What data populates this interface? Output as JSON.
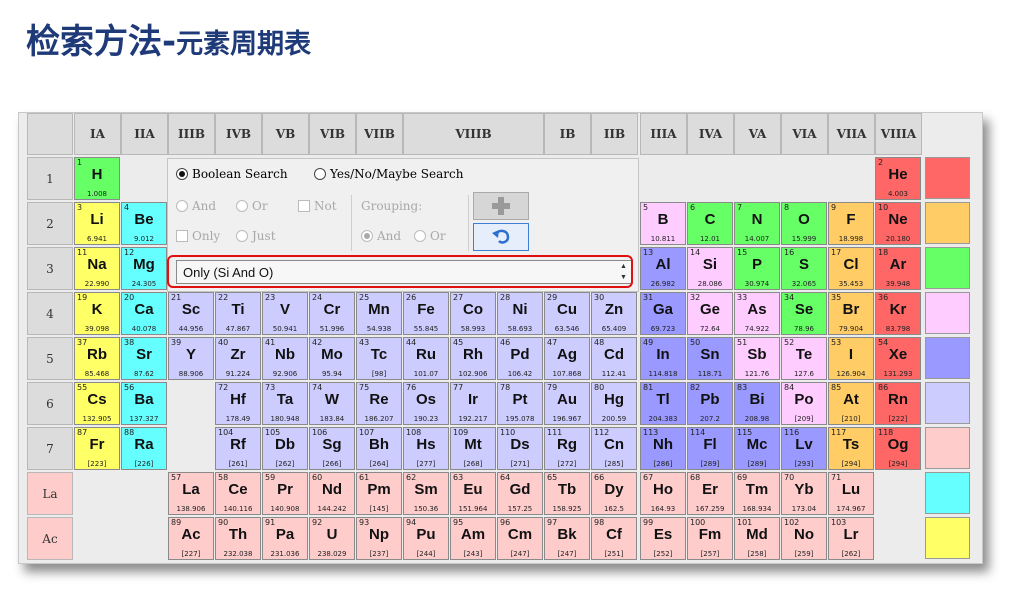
{
  "title": {
    "main": "检索方法-",
    "sub": "元素周期表"
  },
  "colors": {
    "group1": "#ffff66",
    "group2": "#66ffff",
    "transition": "#ccccff",
    "post_transition": "#9999ff",
    "nonmetal": "#66ff66",
    "halogen": "#ffcc66",
    "noble": "#ff6666",
    "lanthanide": "#ffcccc",
    "metalloid": "#ffccff"
  },
  "group_headers": [
    "IA",
    "IIA",
    "IIIB",
    "IVB",
    "VB",
    "VIB",
    "VIIB",
    "VIIIB",
    "IB",
    "IIB",
    "IIIA",
    "IVA",
    "VA",
    "VIA",
    "VIIA",
    "VIIIA"
  ],
  "period_labels": [
    "1",
    "2",
    "3",
    "4",
    "5",
    "6",
    "7",
    "La",
    "Ac"
  ],
  "search_panel": {
    "boolean_label": "Boolean Search",
    "yesno_label": "Yes/No/Maybe Search",
    "and_label": "And",
    "or_label": "Or",
    "not_label": "Not",
    "only_label": "Only",
    "just_label": "Just",
    "grouping_label": "Grouping:",
    "grouping_and": "And",
    "grouping_or": "Or",
    "add_icon": "plus-icon",
    "undo_icon": "undo-icon",
    "query_value": "Only (Si And O)"
  },
  "elements": [
    {
      "n": 1,
      "s": "H",
      "m": "1.008",
      "p": 0,
      "g": 0,
      "c": "nonmetal"
    },
    {
      "n": 2,
      "s": "He",
      "m": "4.003",
      "p": 0,
      "g": 17,
      "c": "noble"
    },
    {
      "n": 3,
      "s": "Li",
      "m": "6.941",
      "p": 1,
      "g": 0,
      "c": "group1"
    },
    {
      "n": 4,
      "s": "Be",
      "m": "9.012",
      "p": 1,
      "g": 1,
      "c": "group2"
    },
    {
      "n": 5,
      "s": "B",
      "m": "10.811",
      "p": 1,
      "g": 12,
      "c": "metalloid"
    },
    {
      "n": 6,
      "s": "C",
      "m": "12.01",
      "p": 1,
      "g": 13,
      "c": "nonmetal"
    },
    {
      "n": 7,
      "s": "N",
      "m": "14.007",
      "p": 1,
      "g": 14,
      "c": "nonmetal"
    },
    {
      "n": 8,
      "s": "O",
      "m": "15.999",
      "p": 1,
      "g": 15,
      "c": "nonmetal"
    },
    {
      "n": 9,
      "s": "F",
      "m": "18.998",
      "p": 1,
      "g": 16,
      "c": "halogen"
    },
    {
      "n": 10,
      "s": "Ne",
      "m": "20.180",
      "p": 1,
      "g": 17,
      "c": "noble"
    },
    {
      "n": 11,
      "s": "Na",
      "m": "22.990",
      "p": 2,
      "g": 0,
      "c": "group1"
    },
    {
      "n": 12,
      "s": "Mg",
      "m": "24.305",
      "p": 2,
      "g": 1,
      "c": "group2"
    },
    {
      "n": 13,
      "s": "Al",
      "m": "26.982",
      "p": 2,
      "g": 12,
      "c": "post_transition"
    },
    {
      "n": 14,
      "s": "Si",
      "m": "28.086",
      "p": 2,
      "g": 13,
      "c": "metalloid"
    },
    {
      "n": 15,
      "s": "P",
      "m": "30.974",
      "p": 2,
      "g": 14,
      "c": "nonmetal"
    },
    {
      "n": 16,
      "s": "S",
      "m": "32.065",
      "p": 2,
      "g": 15,
      "c": "nonmetal"
    },
    {
      "n": 17,
      "s": "Cl",
      "m": "35.453",
      "p": 2,
      "g": 16,
      "c": "halogen"
    },
    {
      "n": 18,
      "s": "Ar",
      "m": "39.948",
      "p": 2,
      "g": 17,
      "c": "noble"
    },
    {
      "n": 19,
      "s": "K",
      "m": "39.098",
      "p": 3,
      "g": 0,
      "c": "group1"
    },
    {
      "n": 20,
      "s": "Ca",
      "m": "40.078",
      "p": 3,
      "g": 1,
      "c": "group2"
    },
    {
      "n": 21,
      "s": "Sc",
      "m": "44.956",
      "p": 3,
      "g": 2,
      "c": "transition"
    },
    {
      "n": 22,
      "s": "Ti",
      "m": "47.867",
      "p": 3,
      "g": 3,
      "c": "transition"
    },
    {
      "n": 23,
      "s": "V",
      "m": "50.941",
      "p": 3,
      "g": 4,
      "c": "transition"
    },
    {
      "n": 24,
      "s": "Cr",
      "m": "51.996",
      "p": 3,
      "g": 5,
      "c": "transition"
    },
    {
      "n": 25,
      "s": "Mn",
      "m": "54.938",
      "p": 3,
      "g": 6,
      "c": "transition"
    },
    {
      "n": 26,
      "s": "Fe",
      "m": "55.845",
      "p": 3,
      "g": 7,
      "c": "transition"
    },
    {
      "n": 27,
      "s": "Co",
      "m": "58.993",
      "p": 3,
      "g": 8,
      "c": "transition"
    },
    {
      "n": 28,
      "s": "Ni",
      "m": "58.693",
      "p": 3,
      "g": 9,
      "c": "transition"
    },
    {
      "n": 29,
      "s": "Cu",
      "m": "63.546",
      "p": 3,
      "g": 10,
      "c": "transition"
    },
    {
      "n": 30,
      "s": "Zn",
      "m": "65.409",
      "p": 3,
      "g": 11,
      "c": "transition"
    },
    {
      "n": 31,
      "s": "Ga",
      "m": "69.723",
      "p": 3,
      "g": 12,
      "c": "post_transition"
    },
    {
      "n": 32,
      "s": "Ge",
      "m": "72.64",
      "p": 3,
      "g": 13,
      "c": "metalloid"
    },
    {
      "n": 33,
      "s": "As",
      "m": "74.922",
      "p": 3,
      "g": 14,
      "c": "metalloid"
    },
    {
      "n": 34,
      "s": "Se",
      "m": "78.96",
      "p": 3,
      "g": 15,
      "c": "nonmetal"
    },
    {
      "n": 35,
      "s": "Br",
      "m": "79.904",
      "p": 3,
      "g": 16,
      "c": "halogen"
    },
    {
      "n": 36,
      "s": "Kr",
      "m": "83.798",
      "p": 3,
      "g": 17,
      "c": "noble"
    },
    {
      "n": 37,
      "s": "Rb",
      "m": "85.468",
      "p": 4,
      "g": 0,
      "c": "group1"
    },
    {
      "n": 38,
      "s": "Sr",
      "m": "87.62",
      "p": 4,
      "g": 1,
      "c": "group2"
    },
    {
      "n": 39,
      "s": "Y",
      "m": "88.906",
      "p": 4,
      "g": 2,
      "c": "transition"
    },
    {
      "n": 40,
      "s": "Zr",
      "m": "91.224",
      "p": 4,
      "g": 3,
      "c": "transition"
    },
    {
      "n": 41,
      "s": "Nb",
      "m": "92.906",
      "p": 4,
      "g": 4,
      "c": "transition"
    },
    {
      "n": 42,
      "s": "Mo",
      "m": "95.94",
      "p": 4,
      "g": 5,
      "c": "transition"
    },
    {
      "n": 43,
      "s": "Tc",
      "m": "[98]",
      "p": 4,
      "g": 6,
      "c": "transition"
    },
    {
      "n": 44,
      "s": "Ru",
      "m": "101.07",
      "p": 4,
      "g": 7,
      "c": "transition"
    },
    {
      "n": 45,
      "s": "Rh",
      "m": "102.906",
      "p": 4,
      "g": 8,
      "c": "transition"
    },
    {
      "n": 46,
      "s": "Pd",
      "m": "106.42",
      "p": 4,
      "g": 9,
      "c": "transition"
    },
    {
      "n": 47,
      "s": "Ag",
      "m": "107.868",
      "p": 4,
      "g": 10,
      "c": "transition"
    },
    {
      "n": 48,
      "s": "Cd",
      "m": "112.41",
      "p": 4,
      "g": 11,
      "c": "transition"
    },
    {
      "n": 49,
      "s": "In",
      "m": "114.818",
      "p": 4,
      "g": 12,
      "c": "post_transition"
    },
    {
      "n": 50,
      "s": "Sn",
      "m": "118.71",
      "p": 4,
      "g": 13,
      "c": "post_transition"
    },
    {
      "n": 51,
      "s": "Sb",
      "m": "121.76",
      "p": 4,
      "g": 14,
      "c": "metalloid"
    },
    {
      "n": 52,
      "s": "Te",
      "m": "127.6",
      "p": 4,
      "g": 15,
      "c": "metalloid"
    },
    {
      "n": 53,
      "s": "I",
      "m": "126.904",
      "p": 4,
      "g": 16,
      "c": "halogen"
    },
    {
      "n": 54,
      "s": "Xe",
      "m": "131.293",
      "p": 4,
      "g": 17,
      "c": "noble"
    },
    {
      "n": 55,
      "s": "Cs",
      "m": "132.905",
      "p": 5,
      "g": 0,
      "c": "group1"
    },
    {
      "n": 56,
      "s": "Ba",
      "m": "137.327",
      "p": 5,
      "g": 1,
      "c": "group2"
    },
    {
      "n": 72,
      "s": "Hf",
      "m": "178.49",
      "p": 5,
      "g": 3,
      "c": "transition"
    },
    {
      "n": 73,
      "s": "Ta",
      "m": "180.948",
      "p": 5,
      "g": 4,
      "c": "transition"
    },
    {
      "n": 74,
      "s": "W",
      "m": "183.84",
      "p": 5,
      "g": 5,
      "c": "transition"
    },
    {
      "n": 75,
      "s": "Re",
      "m": "186.207",
      "p": 5,
      "g": 6,
      "c": "transition"
    },
    {
      "n": 76,
      "s": "Os",
      "m": "190.23",
      "p": 5,
      "g": 7,
      "c": "transition"
    },
    {
      "n": 77,
      "s": "Ir",
      "m": "192.217",
      "p": 5,
      "g": 8,
      "c": "transition"
    },
    {
      "n": 78,
      "s": "Pt",
      "m": "195.078",
      "p": 5,
      "g": 9,
      "c": "transition"
    },
    {
      "n": 79,
      "s": "Au",
      "m": "196.967",
      "p": 5,
      "g": 10,
      "c": "transition"
    },
    {
      "n": 80,
      "s": "Hg",
      "m": "200.59",
      "p": 5,
      "g": 11,
      "c": "transition"
    },
    {
      "n": 81,
      "s": "Tl",
      "m": "204.383",
      "p": 5,
      "g": 12,
      "c": "post_transition"
    },
    {
      "n": 82,
      "s": "Pb",
      "m": "207.2",
      "p": 5,
      "g": 13,
      "c": "post_transition"
    },
    {
      "n": 83,
      "s": "Bi",
      "m": "208.98",
      "p": 5,
      "g": 14,
      "c": "post_transition"
    },
    {
      "n": 84,
      "s": "Po",
      "m": "[209]",
      "p": 5,
      "g": 15,
      "c": "metalloid"
    },
    {
      "n": 85,
      "s": "At",
      "m": "[210]",
      "p": 5,
      "g": 16,
      "c": "halogen"
    },
    {
      "n": 86,
      "s": "Rn",
      "m": "[222]",
      "p": 5,
      "g": 17,
      "c": "noble"
    },
    {
      "n": 87,
      "s": "Fr",
      "m": "[223]",
      "p": 6,
      "g": 0,
      "c": "group1"
    },
    {
      "n": 88,
      "s": "Ra",
      "m": "[226]",
      "p": 6,
      "g": 1,
      "c": "group2"
    },
    {
      "n": 104,
      "s": "Rf",
      "m": "[261]",
      "p": 6,
      "g": 3,
      "c": "transition"
    },
    {
      "n": 105,
      "s": "Db",
      "m": "[262]",
      "p": 6,
      "g": 4,
      "c": "transition"
    },
    {
      "n": 106,
      "s": "Sg",
      "m": "[266]",
      "p": 6,
      "g": 5,
      "c": "transition"
    },
    {
      "n": 107,
      "s": "Bh",
      "m": "[264]",
      "p": 6,
      "g": 6,
      "c": "transition"
    },
    {
      "n": 108,
      "s": "Hs",
      "m": "[277]",
      "p": 6,
      "g": 7,
      "c": "transition"
    },
    {
      "n": 109,
      "s": "Mt",
      "m": "[268]",
      "p": 6,
      "g": 8,
      "c": "transition"
    },
    {
      "n": 110,
      "s": "Ds",
      "m": "[271]",
      "p": 6,
      "g": 9,
      "c": "transition"
    },
    {
      "n": 111,
      "s": "Rg",
      "m": "[272]",
      "p": 6,
      "g": 10,
      "c": "transition"
    },
    {
      "n": 112,
      "s": "Cn",
      "m": "[285]",
      "p": 6,
      "g": 11,
      "c": "transition"
    },
    {
      "n": 113,
      "s": "Nh",
      "m": "[286]",
      "p": 6,
      "g": 12,
      "c": "post_transition"
    },
    {
      "n": 114,
      "s": "Fl",
      "m": "[289]",
      "p": 6,
      "g": 13,
      "c": "post_transition"
    },
    {
      "n": 115,
      "s": "Mc",
      "m": "[289]",
      "p": 6,
      "g": 14,
      "c": "post_transition"
    },
    {
      "n": 116,
      "s": "Lv",
      "m": "[293]",
      "p": 6,
      "g": 15,
      "c": "post_transition"
    },
    {
      "n": 117,
      "s": "Ts",
      "m": "[294]",
      "p": 6,
      "g": 16,
      "c": "halogen"
    },
    {
      "n": 118,
      "s": "Og",
      "m": "[294]",
      "p": 6,
      "g": 17,
      "c": "noble"
    },
    {
      "n": 57,
      "s": "La",
      "m": "138.906",
      "p": 7,
      "g": 2,
      "c": "lanthanide"
    },
    {
      "n": 58,
      "s": "Ce",
      "m": "140.116",
      "p": 7,
      "g": 3,
      "c": "lanthanide"
    },
    {
      "n": 59,
      "s": "Pr",
      "m": "140.908",
      "p": 7,
      "g": 4,
      "c": "lanthanide"
    },
    {
      "n": 60,
      "s": "Nd",
      "m": "144.242",
      "p": 7,
      "g": 5,
      "c": "lanthanide"
    },
    {
      "n": 61,
      "s": "Pm",
      "m": "[145]",
      "p": 7,
      "g": 6,
      "c": "lanthanide"
    },
    {
      "n": 62,
      "s": "Sm",
      "m": "150.36",
      "p": 7,
      "g": 7,
      "c": "lanthanide"
    },
    {
      "n": 63,
      "s": "Eu",
      "m": "151.964",
      "p": 7,
      "g": 8,
      "c": "lanthanide"
    },
    {
      "n": 64,
      "s": "Gd",
      "m": "157.25",
      "p": 7,
      "g": 9,
      "c": "lanthanide"
    },
    {
      "n": 65,
      "s": "Tb",
      "m": "158.925",
      "p": 7,
      "g": 10,
      "c": "lanthanide"
    },
    {
      "n": 66,
      "s": "Dy",
      "m": "162.5",
      "p": 7,
      "g": 11,
      "c": "lanthanide"
    },
    {
      "n": 67,
      "s": "Ho",
      "m": "164.93",
      "p": 7,
      "g": 12,
      "c": "lanthanide"
    },
    {
      "n": 68,
      "s": "Er",
      "m": "167.259",
      "p": 7,
      "g": 13,
      "c": "lanthanide"
    },
    {
      "n": 69,
      "s": "Tm",
      "m": "168.934",
      "p": 7,
      "g": 14,
      "c": "lanthanide"
    },
    {
      "n": 70,
      "s": "Yb",
      "m": "173.04",
      "p": 7,
      "g": 15,
      "c": "lanthanide"
    },
    {
      "n": 71,
      "s": "Lu",
      "m": "174.967",
      "p": 7,
      "g": 16,
      "c": "lanthanide"
    },
    {
      "n": 89,
      "s": "Ac",
      "m": "[227]",
      "p": 8,
      "g": 2,
      "c": "lanthanide"
    },
    {
      "n": 90,
      "s": "Th",
      "m": "232.038",
      "p": 8,
      "g": 3,
      "c": "lanthanide"
    },
    {
      "n": 91,
      "s": "Pa",
      "m": "231.036",
      "p": 8,
      "g": 4,
      "c": "lanthanide"
    },
    {
      "n": 92,
      "s": "U",
      "m": "238.029",
      "p": 8,
      "g": 5,
      "c": "lanthanide"
    },
    {
      "n": 93,
      "s": "Np",
      "m": "[237]",
      "p": 8,
      "g": 6,
      "c": "lanthanide"
    },
    {
      "n": 94,
      "s": "Pu",
      "m": "[244]",
      "p": 8,
      "g": 7,
      "c": "lanthanide"
    },
    {
      "n": 95,
      "s": "Am",
      "m": "[243]",
      "p": 8,
      "g": 8,
      "c": "lanthanide"
    },
    {
      "n": 96,
      "s": "Cm",
      "m": "[247]",
      "p": 8,
      "g": 9,
      "c": "lanthanide"
    },
    {
      "n": 97,
      "s": "Bk",
      "m": "[247]",
      "p": 8,
      "g": 10,
      "c": "lanthanide"
    },
    {
      "n": 98,
      "s": "Cf",
      "m": "[251]",
      "p": 8,
      "g": 11,
      "c": "lanthanide"
    },
    {
      "n": 99,
      "s": "Es",
      "m": "[252]",
      "p": 8,
      "g": 12,
      "c": "lanthanide"
    },
    {
      "n": 100,
      "s": "Fm",
      "m": "[257]",
      "p": 8,
      "g": 13,
      "c": "lanthanide"
    },
    {
      "n": 101,
      "s": "Md",
      "m": "[258]",
      "p": 8,
      "g": 14,
      "c": "lanthanide"
    },
    {
      "n": 102,
      "s": "No",
      "m": "[259]",
      "p": 8,
      "g": 15,
      "c": "lanthanide"
    },
    {
      "n": 103,
      "s": "Lr",
      "m": "[262]",
      "p": 8,
      "g": 16,
      "c": "lanthanide"
    }
  ],
  "legend_strip": [
    "noble",
    "halogen",
    "nonmetal",
    "metalloid",
    "post_transition",
    "transition",
    "lanthanide",
    "group2",
    "group1"
  ]
}
